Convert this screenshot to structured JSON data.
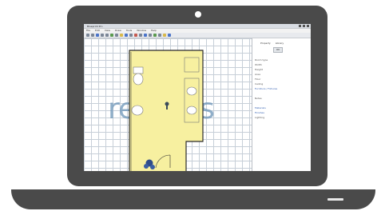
{
  "app": {
    "title": "Blueprint Pro",
    "menu": [
      "File",
      "Edit",
      "View",
      "Draw",
      "Tools",
      "Window",
      "Help"
    ]
  },
  "toolbar": {
    "tools": [
      "new-icon",
      "open-icon",
      "save-icon",
      "undo-icon",
      "redo-icon",
      "select-icon",
      "wall-icon",
      "door-icon",
      "window-icon",
      "room-icon",
      "dimension-icon",
      "text-icon",
      "zoom-in-icon",
      "zoom-out-icon",
      "pan-icon",
      "grid-icon",
      "layer-icon",
      "render-icon"
    ]
  },
  "canvas": {
    "watermark_left": "re",
    "watermark_right": "es",
    "room_fill": "#f7f0a0",
    "wall_color": "#2b2b2b"
  },
  "panel": {
    "tab_a": "Property",
    "tab_b": "Library",
    "button": "OK",
    "lines": [
      "Room type",
      "Width",
      "Height",
      "Area",
      "Floor",
      "Ceiling",
      "Furniture / Fixtures",
      "",
      "Notes",
      "",
      "Materials",
      "Finishes",
      "Lighting"
    ]
  },
  "colors": {
    "laptop": "#4a4a4a",
    "grid": "#c7cfd8",
    "accent": "#6c95b8"
  }
}
